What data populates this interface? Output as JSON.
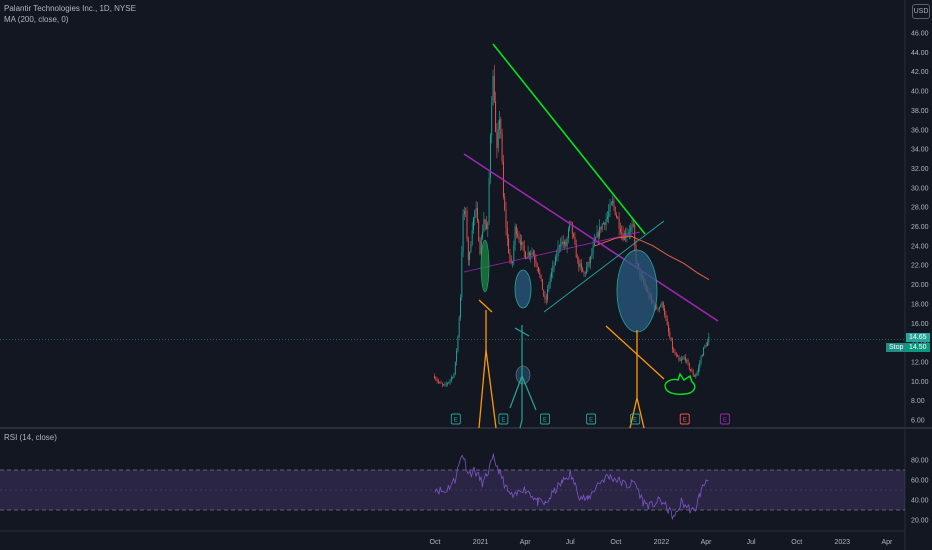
{
  "header": {
    "symbol_line": "Palantir Technologies Inc., 1D, NYSE",
    "ma_line": "MA (200, close, 0)",
    "currency": "USD"
  },
  "rsi_panel": {
    "label": "RSI (14, close)"
  },
  "badges": {
    "price_a": "14.65",
    "price_b": "14.50",
    "ma_label": "Stop"
  },
  "colors": {
    "background": "#131722",
    "up_candle": "#26a69a",
    "down_candle": "#ef5350",
    "ma_line": "#e0624a",
    "green_trendline": "#00e61f",
    "purple_trendline": "#9c27b0",
    "teal_trendline": "#26a69a",
    "orange_annotation": "#ff9800",
    "rsi_line": "#7e57c2",
    "rsi_band": "#7e57c2"
  },
  "chart_data": {
    "type": "candlestick",
    "ticker": "Palantir Technologies Inc.",
    "interval": "1D",
    "exchange": "NYSE",
    "y_range": [
      5.5,
      47
    ],
    "price_ticks": [
      "6.00",
      "8.00",
      "10.00",
      "12.00",
      "14.00",
      "16.00",
      "18.00",
      "20.00",
      "22.00",
      "24.00",
      "26.00",
      "28.00",
      "30.00",
      "32.00",
      "34.00",
      "36.00",
      "38.00",
      "40.00",
      "42.00",
      "44.00",
      "46.00"
    ],
    "x_ticks": [
      "Oct",
      "2021",
      "Apr",
      "Jul",
      "Oct",
      "2022",
      "Apr",
      "Jul",
      "Oct",
      "2023",
      "Apr"
    ],
    "price_path": [
      [
        "2020-09-30",
        10.5
      ],
      [
        "2020-10-09",
        9.8
      ],
      [
        "2020-10-20",
        9.5
      ],
      [
        "2020-10-29",
        10.0
      ],
      [
        "2020-11-09",
        10.8
      ],
      [
        "2020-11-16",
        14.5
      ],
      [
        "2020-11-23",
        20.0
      ],
      [
        "2020-11-25",
        26.5
      ],
      [
        "2020-12-01",
        28.0
      ],
      [
        "2020-12-08",
        22.0
      ],
      [
        "2020-12-15",
        26.0
      ],
      [
        "2020-12-22",
        28.0
      ],
      [
        "2020-12-31",
        23.5
      ],
      [
        "2021-01-08",
        27.0
      ],
      [
        "2021-01-15",
        25.0
      ],
      [
        "2021-01-22",
        38.0
      ],
      [
        "2021-01-27",
        42.0
      ],
      [
        "2021-02-02",
        33.0
      ],
      [
        "2021-02-09",
        38.0
      ],
      [
        "2021-02-16",
        29.0
      ],
      [
        "2021-02-25",
        24.0
      ],
      [
        "2021-03-05",
        21.5
      ],
      [
        "2021-03-12",
        26.0
      ],
      [
        "2021-03-22",
        24.5
      ],
      [
        "2021-04-01",
        23.0
      ],
      [
        "2021-04-14",
        23.5
      ],
      [
        "2021-04-26",
        22.0
      ],
      [
        "2021-05-06",
        19.5
      ],
      [
        "2021-05-12",
        18.0
      ],
      [
        "2021-05-20",
        20.5
      ],
      [
        "2021-06-01",
        22.5
      ],
      [
        "2021-06-10",
        24.5
      ],
      [
        "2021-06-22",
        24.0
      ],
      [
        "2021-07-01",
        26.5
      ],
      [
        "2021-07-15",
        22.5
      ],
      [
        "2021-07-28",
        21.0
      ],
      [
        "2021-08-10",
        22.5
      ],
      [
        "2021-08-20",
        24.5
      ],
      [
        "2021-09-01",
        26.0
      ],
      [
        "2021-09-14",
        27.0
      ],
      [
        "2021-09-24",
        28.5
      ],
      [
        "2021-10-06",
        26.5
      ],
      [
        "2021-10-15",
        25.0
      ],
      [
        "2021-10-25",
        25.5
      ],
      [
        "2021-11-05",
        26.0
      ],
      [
        "2021-11-10",
        22.5
      ],
      [
        "2021-11-19",
        21.0
      ],
      [
        "2021-12-01",
        19.5
      ],
      [
        "2021-12-10",
        18.5
      ],
      [
        "2021-12-20",
        17.5
      ],
      [
        "2022-01-04",
        18.0
      ],
      [
        "2022-01-13",
        15.5
      ],
      [
        "2022-01-25",
        13.0
      ],
      [
        "2022-02-07",
        12.0
      ],
      [
        "2022-02-17",
        12.5
      ],
      [
        "2022-02-25",
        11.5
      ],
      [
        "2022-03-08",
        10.5
      ],
      [
        "2022-03-15",
        11.0
      ],
      [
        "2022-03-22",
        12.5
      ],
      [
        "2022-03-28",
        13.5
      ],
      [
        "2022-04-04",
        14.0
      ],
      [
        "2022-04-07",
        14.5
      ]
    ],
    "ma_200_path": [
      [
        "2021-08-20",
        24.0
      ],
      [
        "2021-10-01",
        24.8
      ],
      [
        "2021-11-01",
        25.0
      ],
      [
        "2021-12-15",
        24.0
      ],
      [
        "2022-01-15",
        23.0
      ],
      [
        "2022-02-15",
        22.2
      ],
      [
        "2022-03-15",
        21.2
      ],
      [
        "2022-04-07",
        20.5
      ]
    ],
    "rsi": {
      "title": "RSI (14, close)",
      "y_range": [
        10,
        85
      ],
      "ticks": [
        "20.00",
        "40.00",
        "60.00",
        "80.00"
      ],
      "band": [
        30,
        70
      ],
      "path": [
        [
          "2020-10-01",
          52
        ],
        [
          "2020-10-20",
          48
        ],
        [
          "2020-11-10",
          60
        ],
        [
          "2020-11-25",
          87
        ],
        [
          "2020-12-08",
          66
        ],
        [
          "2020-12-20",
          70
        ],
        [
          "2021-01-06",
          56
        ],
        [
          "2021-01-27",
          82
        ],
        [
          "2021-02-10",
          66
        ],
        [
          "2021-02-25",
          48
        ],
        [
          "2021-03-10",
          42
        ],
        [
          "2021-03-25",
          52
        ],
        [
          "2021-04-10",
          48
        ],
        [
          "2021-04-26",
          38
        ],
        [
          "2021-05-12",
          36
        ],
        [
          "2021-06-01",
          50
        ],
        [
          "2021-06-15",
          58
        ],
        [
          "2021-07-01",
          66
        ],
        [
          "2021-07-20",
          44
        ],
        [
          "2021-08-05",
          40
        ],
        [
          "2021-08-25",
          56
        ],
        [
          "2021-09-15",
          64
        ],
        [
          "2021-10-05",
          60
        ],
        [
          "2021-10-25",
          54
        ],
        [
          "2021-11-08",
          58
        ],
        [
          "2021-11-25",
          38
        ],
        [
          "2021-12-10",
          34
        ],
        [
          "2021-12-30",
          40
        ],
        [
          "2022-01-15",
          30
        ],
        [
          "2022-01-28",
          22
        ],
        [
          "2022-02-10",
          38
        ],
        [
          "2022-02-25",
          32
        ],
        [
          "2022-03-08",
          28
        ],
        [
          "2022-03-20",
          46
        ],
        [
          "2022-04-01",
          60
        ],
        [
          "2022-04-07",
          64
        ]
      ]
    },
    "earnings_markers": [
      {
        "date": "2020-11-12",
        "label": "E",
        "color": "#26a69a"
      },
      {
        "date": "2021-02-16",
        "label": "E",
        "color": "#26a69a"
      },
      {
        "date": "2021-05-11",
        "label": "E",
        "color": "#26a69a"
      },
      {
        "date": "2021-08-12",
        "label": "E",
        "color": "#26a69a"
      },
      {
        "date": "2021-11-09",
        "label": "E",
        "color": "#26a69a"
      },
      {
        "date": "2022-02-17",
        "label": "E",
        "color": "#ef5350"
      },
      {
        "date": "2022-05-09",
        "label": "E",
        "color": "#9c27b0"
      }
    ],
    "last_price": 14.65,
    "grid": false
  }
}
